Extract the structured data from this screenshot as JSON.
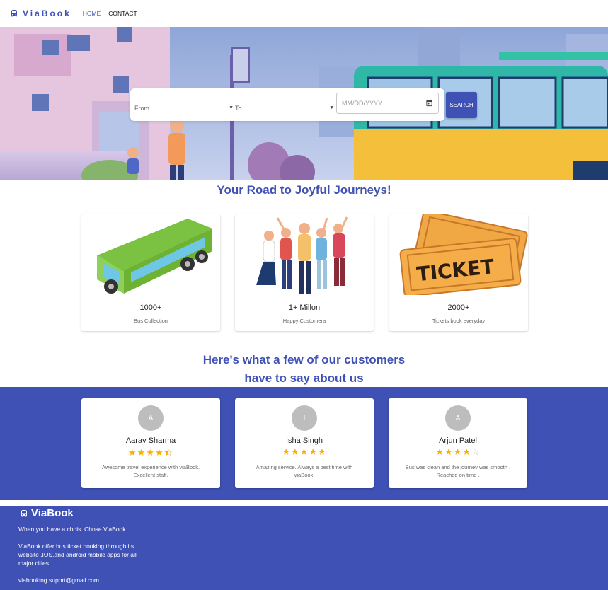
{
  "header": {
    "brand": "ViaBook",
    "nav": {
      "home": "HOME",
      "contact": "CONTACT"
    }
  },
  "search": {
    "from_label": "From",
    "to_label": "To",
    "date_placeholder": "MM/DD/YYYY",
    "button_label": "SEARCH"
  },
  "headline": "Your Road to Joyful Journeys!",
  "stats": [
    {
      "value": "1000+",
      "label": "Bus Collection",
      "image": "bus-illustration"
    },
    {
      "value": "1+ Millon",
      "label": "Happy Customera",
      "image": "happy-people-illustration"
    },
    {
      "value": "2000+",
      "label": "Tickets book everyday",
      "image": "ticket-illustration"
    }
  ],
  "testimonials": {
    "title_line1": "Here's what a few of our customers",
    "title_line2": "have to say about us",
    "items": [
      {
        "initial": "A",
        "name": "Aarav Sharma",
        "rating": 4.5,
        "stars": "★★★★⯪",
        "text": "Awesome travel experience with viaBook. Excellent staff."
      },
      {
        "initial": "I",
        "name": "Isha Singh",
        "rating": 5,
        "stars": "★★★★★",
        "text": "Amazing service. Always a best time with viaBook."
      },
      {
        "initial": "A",
        "name": "Arjun Patel",
        "rating": 4,
        "stars": "★★★★",
        "empty_stars": "☆",
        "text": "Bus was clean and the journey was smooth . Reached on time ."
      }
    ]
  },
  "footer": {
    "brand": "ViaBook",
    "tagline": "When you have a chois .Chose ViaBook",
    "description": "ViaBook offer bus ticket booking through its website ,IOS,and android mobile apps for all major cities.",
    "email": "viabooking.suport@gmail.com"
  },
  "colors": {
    "primary": "#3f51b5",
    "star": "#faaf00",
    "avatar": "#bdbdbd"
  }
}
